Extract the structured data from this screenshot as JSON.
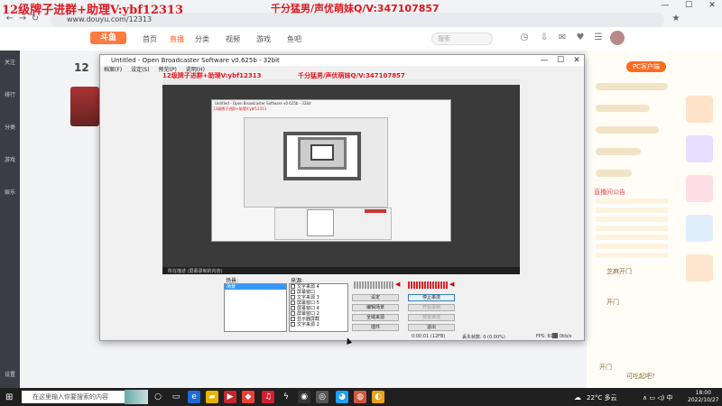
{
  "overlay": {
    "left_text": "12级牌子进群+助理V:ybf12313",
    "right_text": "千分猛男/声优萌妹Q/V:347107857"
  },
  "browser": {
    "url": "www.douyu.com/12313",
    "back": "←",
    "forward": "→",
    "reload": "↻",
    "home": "⌂",
    "star": "★",
    "min": "—",
    "max": "☐",
    "close": "✕"
  },
  "site": {
    "logo": "斗鱼",
    "nav": [
      "首页",
      "直播",
      "分类",
      "视频",
      "游戏",
      "鱼吧"
    ],
    "active_nav": "直播",
    "search_placeholder": "搜索"
  },
  "room": {
    "number": "12"
  },
  "sidebar": {
    "items": [
      "关注",
      "排行",
      "分类",
      "游戏",
      "娱乐",
      "设置"
    ]
  },
  "chat": {
    "pc_client": "PC客户端",
    "lines": [
      {
        "text": "直播间公告"
      },
      {
        "text": "芝麻开门"
      },
      {
        "text": "开门"
      },
      {
        "text": "开门"
      },
      {
        "text": "可吃起吧?"
      }
    ]
  },
  "obs": {
    "title": "Untitled - Open Broadcaster Software v0.625b - 32bit",
    "menu": [
      "档案(F)",
      "设定(S)",
      "预览(P)",
      "说明(H)"
    ],
    "overlay_left": "12级牌子进群+助理V:ybf12313",
    "overlay_right": "千分猛男/声优萌妹Q/V:347107857",
    "scene_label": "场景:",
    "source_label": "来源:",
    "scene_selected": "场景",
    "sources": [
      "文字来源 4",
      "屏幕窗口",
      "文字来源 3",
      "屏幕窗口 5",
      "屏幕窗口 4",
      "屏幕窗口 2",
      "显示器屏截",
      "文字来源 2"
    ],
    "buttons": {
      "settings": "设定",
      "stop_stream": "停止串流",
      "edit_scene": "编辑场景",
      "start_recording": "开始录制",
      "global_sources": "全域来源",
      "preview_stream": "预览串流",
      "plugins": "插件",
      "exit": "退出"
    },
    "status": {
      "time": "0:00:01 (12FB)",
      "dropped": "丢失帧数: 0 (0.00%)",
      "fps": "FPS: 60",
      "kbps": "0kb/s"
    },
    "capture_taskbar": "所在描述 (屏幕录制的内容)"
  },
  "taskbar": {
    "search_placeholder": "在这里输入你要搜索的内容",
    "weather": "22°C 多云",
    "time": "18:00",
    "date": "2022/10/27"
  }
}
